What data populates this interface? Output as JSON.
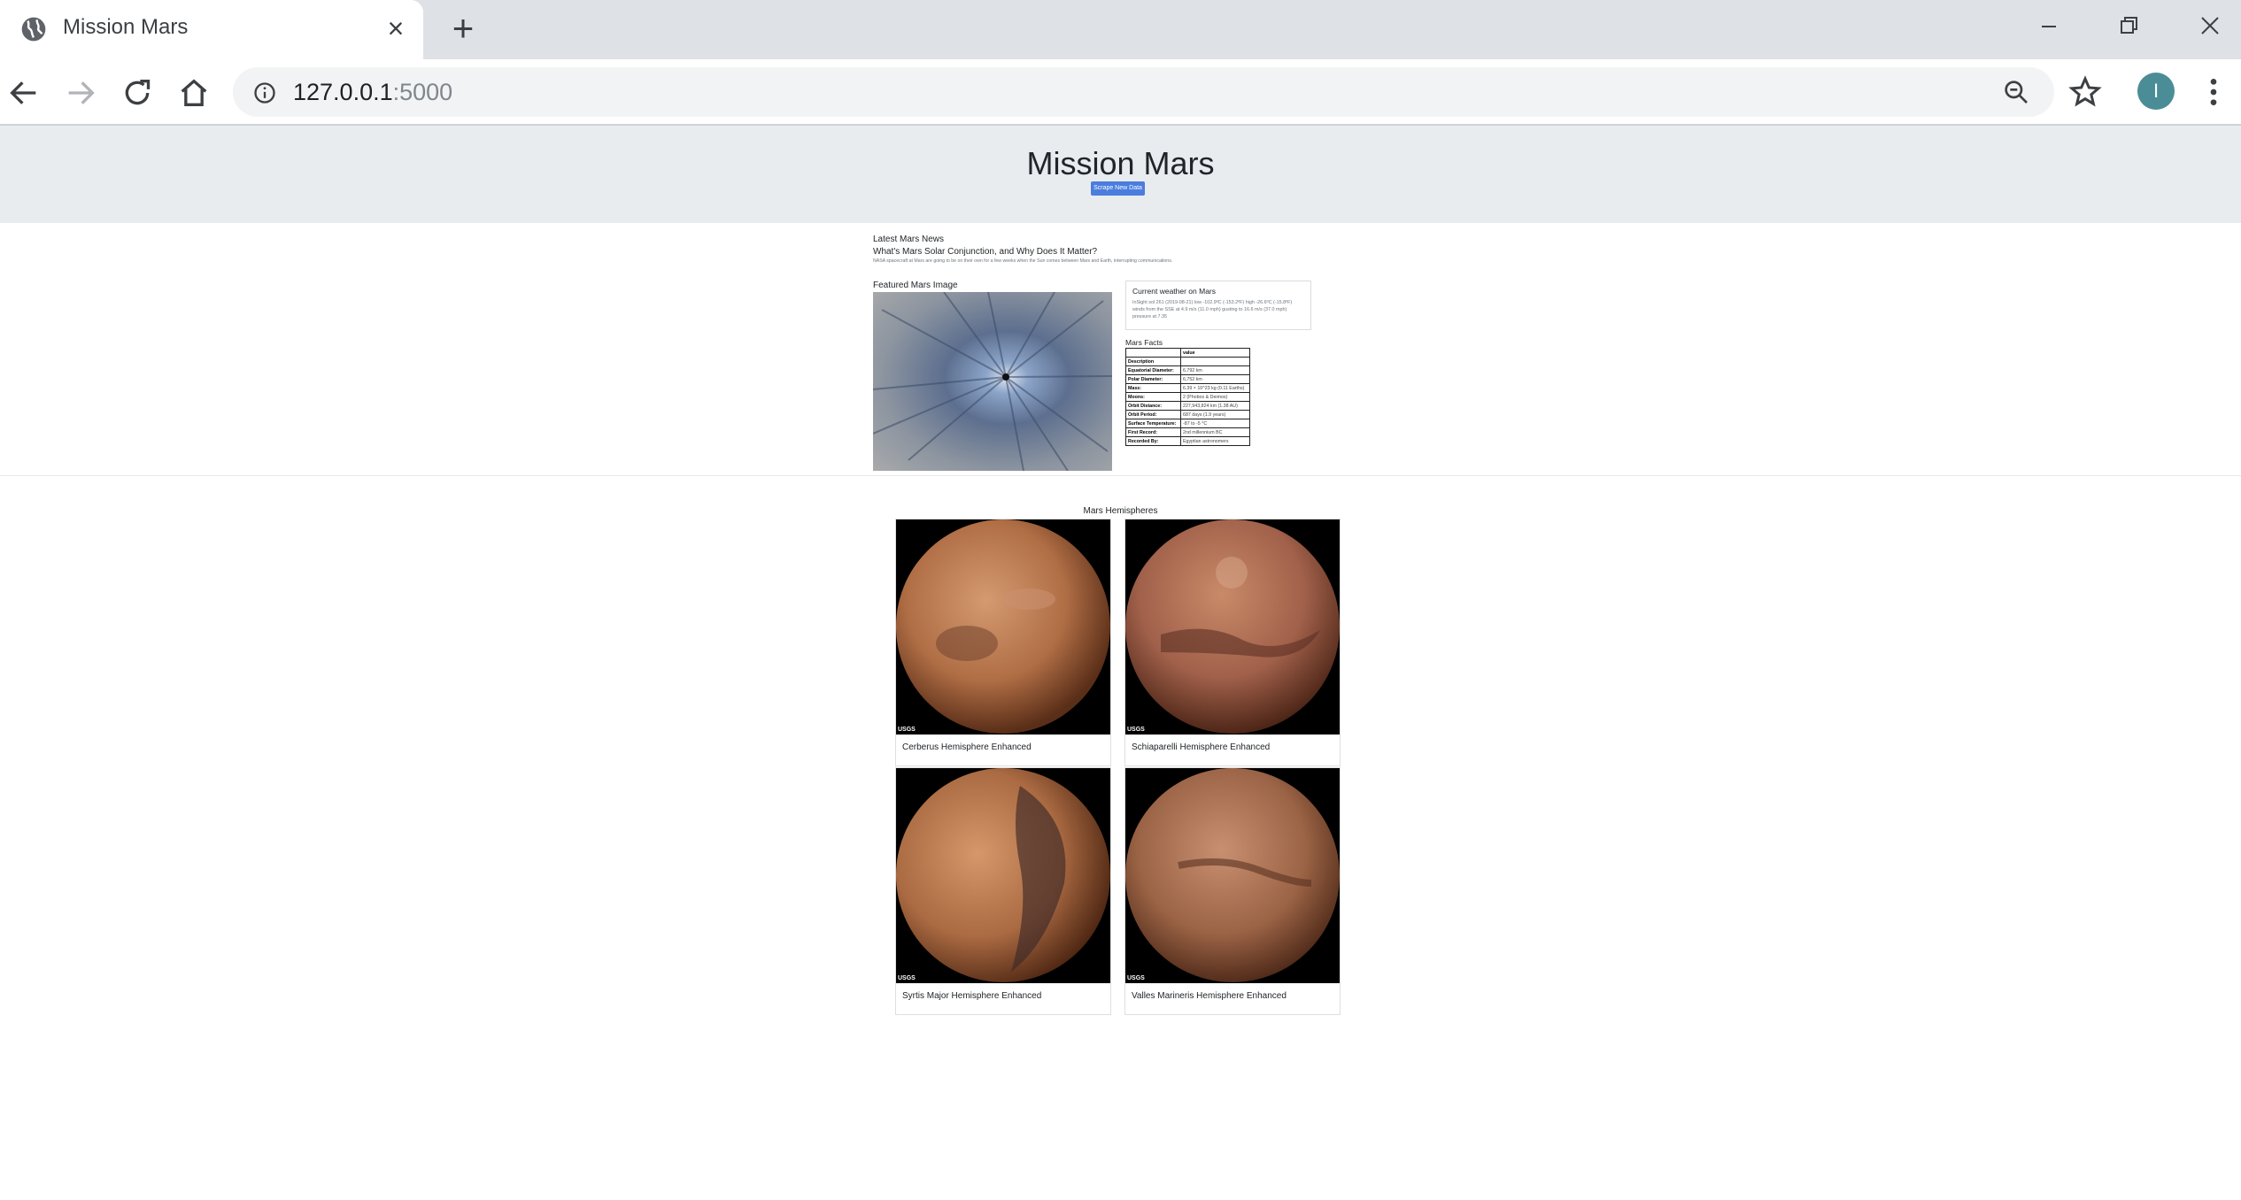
{
  "browser": {
    "tab_title": "Mission Mars",
    "url_host": "127.0.0.1",
    "url_port": ":5000",
    "profile_initial": "I"
  },
  "page": {
    "title": "Mission Mars",
    "scrape_button": "Scrape New Data",
    "news": {
      "header": "Latest Mars News",
      "title": "What's Mars Solar Conjunction, and Why Does It Matter?",
      "teaser": "NASA spacecraft at Mars are going to be on their own for a few weeks when the Sun comes between Mars and Earth, interrupting communications."
    },
    "featured_image": {
      "header": "Featured Mars Image"
    },
    "weather": {
      "header": "Current weather on Mars",
      "text": "InSight sol 261 (2019-08-21) low -102.9ºC (-153.2ºF) high -26.6ºC (-15.8ºF) winds from the SSE at 4.9 m/s (11.0 mph) gusting to 16.6 m/s (37.0 mph) pressure at 7.35"
    },
    "facts": {
      "header": "Mars Facts",
      "column_header": "value",
      "corner_header": "",
      "description_label": "Description",
      "rows": [
        {
          "label": "Equatorial Diameter:",
          "value": "6,792 km"
        },
        {
          "label": "Polar Diameter:",
          "value": "6,752 km"
        },
        {
          "label": "Mass:",
          "value": "6.39 × 10^23 kg (0.11 Earths)"
        },
        {
          "label": "Moons:",
          "value": "2 (Phobos & Deimos)"
        },
        {
          "label": "Orbit Distance:",
          "value": "227,943,824 km (1.38 AU)"
        },
        {
          "label": "Orbit Period:",
          "value": "687 days (1.9 years)"
        },
        {
          "label": "Surface Temperature:",
          "value": "-87 to -5 °C"
        },
        {
          "label": "First Record:",
          "value": "2nd millennium BC"
        },
        {
          "label": "Recorded By:",
          "value": "Egyptian astronomers"
        }
      ]
    },
    "hemispheres": {
      "header": "Mars Hemispheres",
      "items": [
        {
          "title": "Cerberus Hemisphere Enhanced"
        },
        {
          "title": "Schiaparelli Hemisphere Enhanced"
        },
        {
          "title": "Syrtis Major Hemisphere Enhanced"
        },
        {
          "title": "Valles Marineris Hemisphere Enhanced"
        }
      ],
      "usgs_mark": "USGS"
    }
  },
  "colors": {
    "jumbotron": "#e9ecef",
    "button": "#4a7dde",
    "avatar": "#4b8d96"
  }
}
